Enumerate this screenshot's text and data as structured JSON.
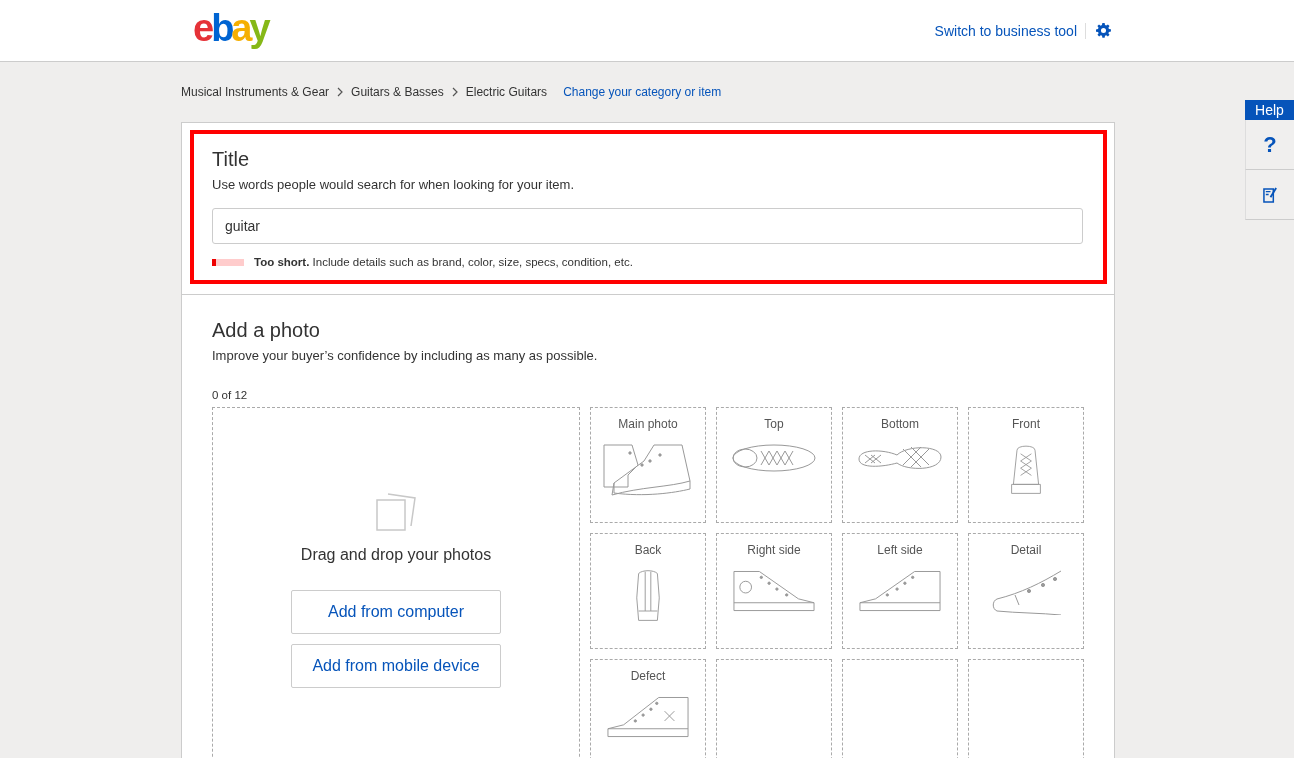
{
  "header": {
    "logo": "ebay",
    "switch_link": "Switch to business tool"
  },
  "breadcrumb": {
    "items": [
      "Musical Instruments & Gear",
      "Guitars & Basses",
      "Electric Guitars"
    ],
    "change_link": "Change your category or item"
  },
  "title_section": {
    "heading": "Title",
    "hint": "Use words people would search for when looking for your item.",
    "value": "guitar",
    "meter": {
      "level": 0.12
    },
    "feedback": "**Too short.** Include details such as brand, color, size, specs, condition, etc."
  },
  "photo_section": {
    "heading": "Add a photo",
    "hint": "Improve your buyer’s confidence by including as many as possible.",
    "count": "0 of 12",
    "drop_text": "Drag and drop your photos",
    "buttons": [
      "Add from computer",
      "Add from mobile device"
    ],
    "slots": [
      {
        "label": "Main photo",
        "kind": "pair"
      },
      {
        "label": "Top",
        "kind": "top"
      },
      {
        "label": "Bottom",
        "kind": "sole"
      },
      {
        "label": "Front",
        "kind": "front"
      },
      {
        "label": "Back",
        "kind": "back"
      },
      {
        "label": "Right side",
        "kind": "right"
      },
      {
        "label": "Left side",
        "kind": "left"
      },
      {
        "label": "Detail",
        "kind": "detail"
      },
      {
        "label": "Defect",
        "kind": "defect"
      },
      {
        "kind": "empty"
      },
      {
        "kind": "empty"
      },
      {
        "kind": "empty"
      }
    ]
  },
  "help": {
    "label": "Help",
    "question": "?"
  }
}
